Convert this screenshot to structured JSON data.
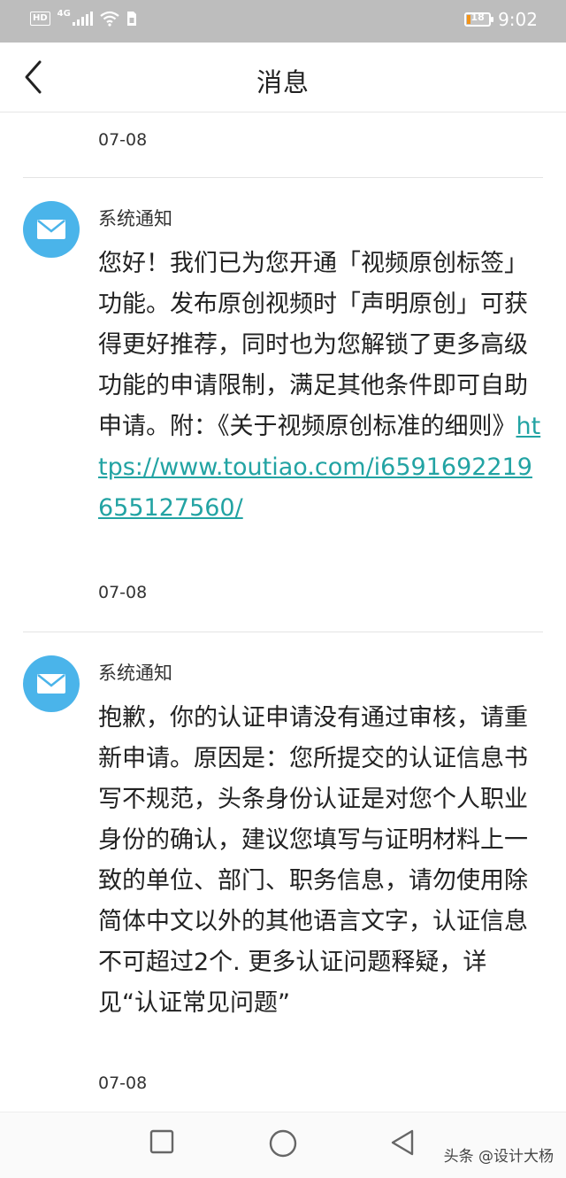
{
  "status_bar": {
    "network_badge": "HD",
    "signal_label": "4G",
    "battery_level": 18,
    "battery_text": "18",
    "time": "9:02"
  },
  "header": {
    "back_icon": "chevron-left-icon",
    "title": "消息"
  },
  "messages": [
    {
      "date": "07-08"
    },
    {
      "sender": "系统通知",
      "avatar_icon": "envelope-icon",
      "text": "您好！我们已为您开通「视频原创标签」功能。发布原创视频时「声明原创」可获得更好推荐，同时也为您解锁了更多高级功能的申请限制，满足其他条件即可自助申请。附：《关于视频原创标准的细则》",
      "link": "https://www.toutiao.com/i6591692219655127560/",
      "date": "07-08"
    },
    {
      "sender": "系统通知",
      "avatar_icon": "envelope-icon",
      "text": "抱歉，你的认证申请没有通过审核，请重新申请。原因是：您所提交的认证信息书写不规范，头条身份认证是对您个人职业身份的确认，建议您填写与证明材料上一致的单位、部门、职务信息，请勿使用除简体中文以外的其他语言文字，认证信息不可超过2个. 更多认证问题释疑，详见“认证常见问题”",
      "date": "07-08"
    }
  ],
  "nav_bar": {
    "recent_icon": "square-icon",
    "home_icon": "circle-icon",
    "back_icon": "triangle-back-icon",
    "watermark": "头条 @设计大杨"
  },
  "colors": {
    "status_bar_bg": "#bdbdbd",
    "avatar_bg": "#4ab4ea",
    "link": "#22a3a3",
    "battery_low": "#f29318"
  }
}
